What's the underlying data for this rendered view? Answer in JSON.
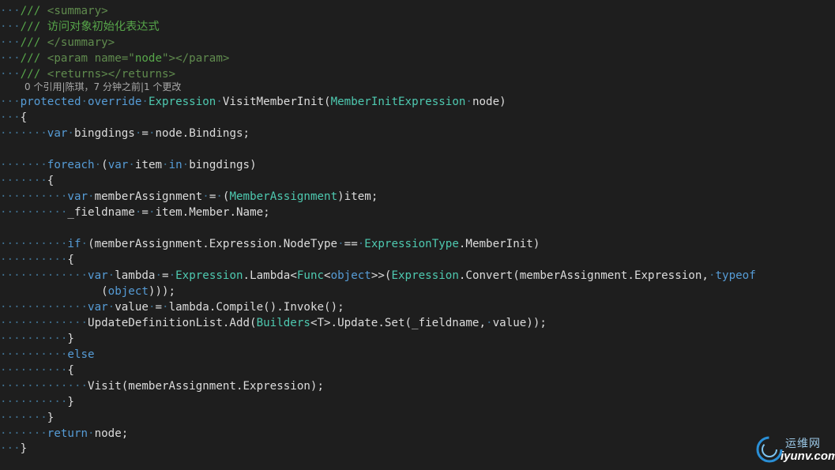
{
  "editor": {
    "codelens": "0 个引用|陈琪，7 分钟之前|1 个更改",
    "lines": [
      [
        [
          "dots",
          "···"
        ],
        [
          "c",
          "/// "
        ],
        [
          "x",
          "<summary>"
        ]
      ],
      [
        [
          "dots",
          "···"
        ],
        [
          "c",
          "/// 访问对象初始化表达式"
        ]
      ],
      [
        [
          "dots",
          "···"
        ],
        [
          "c",
          "/// "
        ],
        [
          "x",
          "</summary>"
        ]
      ],
      [
        [
          "dots",
          "···"
        ],
        [
          "c",
          "/// "
        ],
        [
          "x",
          "<param name=\""
        ],
        [
          "c",
          "node"
        ],
        [
          "x",
          "\"></param>"
        ]
      ],
      [
        [
          "dots",
          "···"
        ],
        [
          "c",
          "/// "
        ],
        [
          "x",
          "<returns></returns>"
        ]
      ],
      [
        [
          "dots",
          "···"
        ],
        [
          "k",
          "protected"
        ],
        [
          "dots",
          "·"
        ],
        [
          "k",
          "override"
        ],
        [
          "dots",
          "·"
        ],
        [
          "t",
          "Expression"
        ],
        [
          "dots",
          "·"
        ],
        [
          "n",
          "VisitMemberInit("
        ],
        [
          "t",
          "MemberInitExpression"
        ],
        [
          "dots",
          "·"
        ],
        [
          "n",
          "node)"
        ]
      ],
      [
        [
          "dots",
          "···"
        ],
        [
          "n",
          "{"
        ]
      ],
      [
        [
          "dots",
          "·······"
        ],
        [
          "k",
          "var"
        ],
        [
          "dots",
          "·"
        ],
        [
          "n",
          "bingdings"
        ],
        [
          "dots",
          "·"
        ],
        [
          "n",
          "="
        ],
        [
          "dots",
          "·"
        ],
        [
          "n",
          "node.Bindings;"
        ]
      ],
      [],
      [
        [
          "dots",
          "·······"
        ],
        [
          "k",
          "foreach"
        ],
        [
          "dots",
          "·"
        ],
        [
          "n",
          "("
        ],
        [
          "k",
          "var"
        ],
        [
          "dots",
          "·"
        ],
        [
          "n",
          "item"
        ],
        [
          "dots",
          "·"
        ],
        [
          "k",
          "in"
        ],
        [
          "dots",
          "·"
        ],
        [
          "n",
          "bingdings)"
        ]
      ],
      [
        [
          "dots",
          "·······"
        ],
        [
          "n",
          "{"
        ]
      ],
      [
        [
          "dots",
          "··········"
        ],
        [
          "k",
          "var"
        ],
        [
          "dots",
          "·"
        ],
        [
          "n",
          "memberAssignment"
        ],
        [
          "dots",
          "·"
        ],
        [
          "n",
          "="
        ],
        [
          "dots",
          "·"
        ],
        [
          "n",
          "("
        ],
        [
          "t",
          "MemberAssignment"
        ],
        [
          "n",
          ")item;"
        ]
      ],
      [
        [
          "dots",
          "··········"
        ],
        [
          "n",
          "_fieldname"
        ],
        [
          "dots",
          "·"
        ],
        [
          "n",
          "="
        ],
        [
          "dots",
          "·"
        ],
        [
          "n",
          "item.Member.Name;"
        ]
      ],
      [],
      [
        [
          "dots",
          "··········"
        ],
        [
          "k",
          "if"
        ],
        [
          "dots",
          "·"
        ],
        [
          "n",
          "(memberAssignment.Expression.NodeType"
        ],
        [
          "dots",
          "·"
        ],
        [
          "n",
          "=="
        ],
        [
          "dots",
          "·"
        ],
        [
          "t",
          "ExpressionType"
        ],
        [
          "n",
          ".MemberInit)"
        ]
      ],
      [
        [
          "dots",
          "··········"
        ],
        [
          "n",
          "{"
        ]
      ],
      [
        [
          "dots",
          "·············"
        ],
        [
          "k",
          "var"
        ],
        [
          "dots",
          "·"
        ],
        [
          "n",
          "lambda"
        ],
        [
          "dots",
          "·"
        ],
        [
          "n",
          "="
        ],
        [
          "dots",
          "·"
        ],
        [
          "t",
          "Expression"
        ],
        [
          "n",
          ".Lambda<"
        ],
        [
          "t",
          "Func"
        ],
        [
          "n",
          "<"
        ],
        [
          "k",
          "object"
        ],
        [
          "n",
          ">>("
        ],
        [
          "t",
          "Expression"
        ],
        [
          "n",
          ".Convert(memberAssignment.Expression,"
        ],
        [
          "dots",
          "·"
        ],
        [
          "k",
          "typeof"
        ]
      ],
      [
        [
          "n",
          "               ("
        ],
        [
          "k",
          "object"
        ],
        [
          "n",
          ")));"
        ]
      ],
      [
        [
          "dots",
          "·············"
        ],
        [
          "k",
          "var"
        ],
        [
          "dots",
          "·"
        ],
        [
          "n",
          "value"
        ],
        [
          "dots",
          "·"
        ],
        [
          "n",
          "="
        ],
        [
          "dots",
          "·"
        ],
        [
          "n",
          "lambda.Compile().Invoke();"
        ]
      ],
      [
        [
          "dots",
          "·············"
        ],
        [
          "n",
          "UpdateDefinitionList.Add("
        ],
        [
          "t",
          "Builders"
        ],
        [
          "n",
          "<T>.Update.Set(_fieldname,"
        ],
        [
          "dots",
          "·"
        ],
        [
          "n",
          "value));"
        ]
      ],
      [
        [
          "dots",
          "··········"
        ],
        [
          "n",
          "}"
        ]
      ],
      [
        [
          "dots",
          "··········"
        ],
        [
          "k",
          "else"
        ]
      ],
      [
        [
          "dots",
          "··········"
        ],
        [
          "n",
          "{"
        ]
      ],
      [
        [
          "dots",
          "·············"
        ],
        [
          "n",
          "Visit(memberAssignment.Expression);"
        ]
      ],
      [
        [
          "dots",
          "··········"
        ],
        [
          "n",
          "}"
        ]
      ],
      [
        [
          "dots",
          "·······"
        ],
        [
          "n",
          "}"
        ]
      ],
      [
        [
          "dots",
          "·······"
        ],
        [
          "k",
          "return"
        ],
        [
          "dots",
          "·"
        ],
        [
          "n",
          "node;"
        ]
      ],
      [
        [
          "dots",
          "···"
        ],
        [
          "n",
          "}"
        ]
      ]
    ]
  },
  "watermark": {
    "cn": "运维网",
    "url": "iyunv.com"
  }
}
